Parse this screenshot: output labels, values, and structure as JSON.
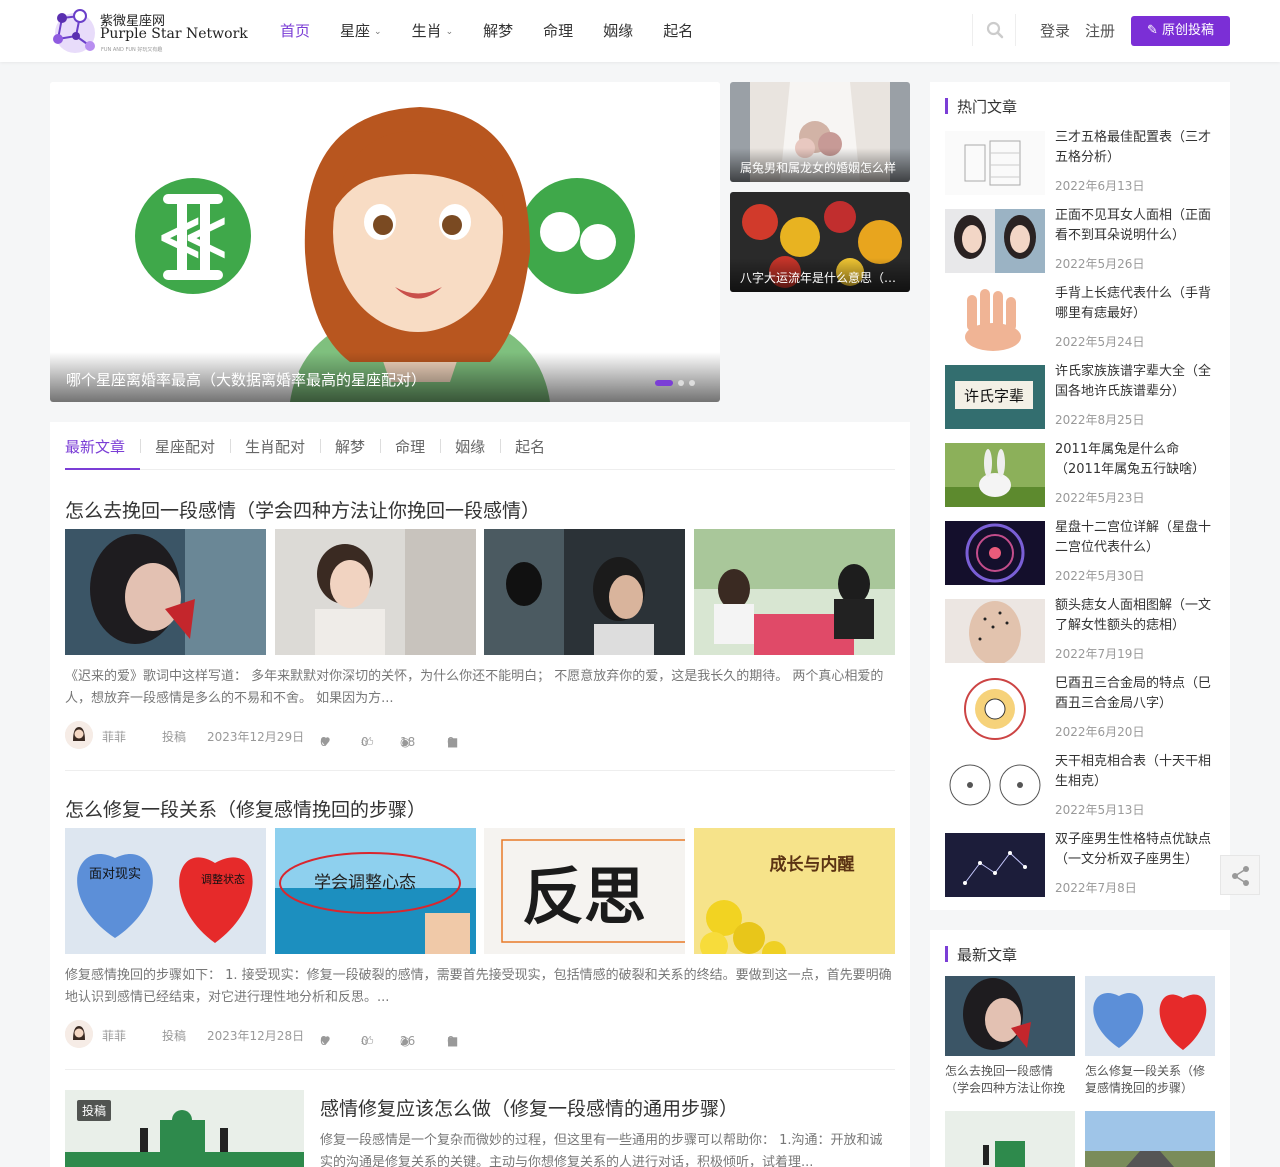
{
  "header": {
    "logo_cn": "紫微星座网",
    "logo_en": "Purple Star Network",
    "logo_sub": "FUN AND FUN 好玩又有趣",
    "nav": [
      {
        "label": "首页",
        "active": true,
        "dropdown": false
      },
      {
        "label": "星座",
        "active": false,
        "dropdown": true
      },
      {
        "label": "生肖",
        "active": false,
        "dropdown": true
      },
      {
        "label": "解梦",
        "active": false,
        "dropdown": false
      },
      {
        "label": "命理",
        "active": false,
        "dropdown": false
      },
      {
        "label": "姻缘",
        "active": false,
        "dropdown": false
      },
      {
        "label": "起名",
        "active": false,
        "dropdown": false
      }
    ],
    "login": "登录",
    "register": "注册",
    "submit": "原创投稿",
    "accent": "#7b2fd6"
  },
  "slider": {
    "caption": "哪个星座离婚率最高（大数据离婚率最高的星座配对）",
    "side": [
      {
        "caption": "属兔男和属龙女的婚姻怎么样"
      },
      {
        "caption": "八字大运流年是什么意思（八字大运流年怎么看）"
      }
    ]
  },
  "tabs": [
    "最新文章",
    "星座配对",
    "生肖配对",
    "解梦",
    "命理",
    "姻缘",
    "起名"
  ],
  "posts": [
    {
      "title": "怎么去挽回一段感情（学会四种方法让你挽回一段感情）",
      "excerpt": "《迟来的爱》歌词中这样写道： 多年来默默对你深切的关怀，为什么你还不能明白； 不愿意放弃你的爱，这是我长久的期待。 两个真心相爱的人，想放弃一段感情是多么的不易和不舍。 如果因为方...",
      "author": "菲菲",
      "category": "投稿",
      "date": "2023年12月29日",
      "likes": "0",
      "thumbs": "0",
      "views": "18",
      "comments": "0"
    },
    {
      "title": "怎么修复一段关系（修复感情挽回的步骤）",
      "excerpt": "修复感情挽回的步骤如下： 1. 接受现实：修复一段破裂的感情，需要首先接受现实，包括情感的破裂和关系的终结。要做到这一点，首先要明确地认识到感情已经结束，对它进行理性地分析和反思。...",
      "author": "菲菲",
      "category": "投稿",
      "date": "2023年12月28日",
      "likes": "0",
      "thumbs": "0",
      "views": "26",
      "comments": "0",
      "img_texts": [
        "面对现实",
        "调整状态",
        "学会调整心态",
        "反思",
        "成长与内醒"
      ]
    },
    {
      "title": "感情修复应该怎么做（修复一段感情的通用步骤）",
      "excerpt": "修复一段感情是一个复杂而微妙的过程，但这里有一些通用的步骤可以帮助你： 1.沟通：开放和诚实的沟通是修复关系的关键。主动与你想修复关系的人进行对话，积极倾听，试着理...",
      "badge": "投稿"
    }
  ],
  "hot": {
    "title": "热门文章",
    "items": [
      {
        "title": "三才五格最佳配置表（三才五格分析）",
        "date": "2022年6月13日"
      },
      {
        "title": "正面不见耳女人面相（正面看不到耳朵说明什么）",
        "date": "2022年5月26日"
      },
      {
        "title": "手背上长痣代表什么（手背哪里有痣最好）",
        "date": "2022年5月24日"
      },
      {
        "title": "许氏家族族谱字辈大全（全国各地许氏族谱辈分）",
        "date": "2022年8月25日",
        "img_text": "许氏字辈"
      },
      {
        "title": "2011年属兔是什么命（2011年属兔五行缺啥）",
        "date": "2022年5月23日"
      },
      {
        "title": "星盘十二宫位详解（星盘十二宫位代表什么）",
        "date": "2022年5月30日"
      },
      {
        "title": "额头痣女人面相图解（一文了解女性额头的痣相）",
        "date": "2022年7月19日"
      },
      {
        "title": "巳酉丑三合金局的特点（巳酉丑三合金局八字）",
        "date": "2022年6月20日"
      },
      {
        "title": "天干相克相合表（十天干相生相克）",
        "date": "2022年5月13日"
      },
      {
        "title": "双子座男生性格特点优缺点（一文分析双子座男生）",
        "date": "2022年7月8日"
      }
    ]
  },
  "latest": {
    "title": "最新文章",
    "items": [
      {
        "title": "怎么去挽回一段感情（学会四种方法让你挽回一段感情）"
      },
      {
        "title": "怎么修复一段关系（修复感情挽回的步骤）"
      }
    ]
  }
}
